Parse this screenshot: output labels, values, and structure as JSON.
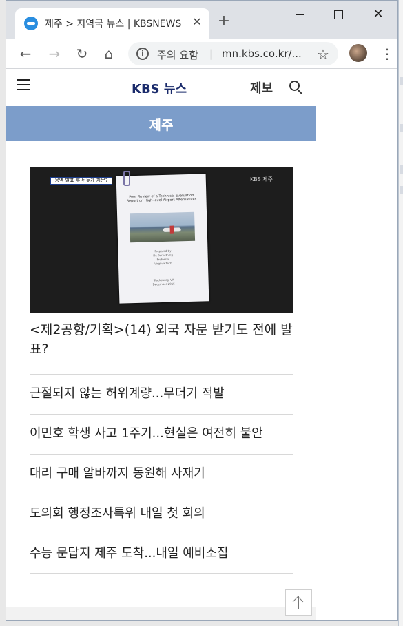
{
  "browser": {
    "tab": {
      "title": "제주 > 지역국 뉴스 | KBSNEWS",
      "close_label": "✕"
    },
    "new_tab_label": "+",
    "window_buttons": {
      "close_label": "✕"
    },
    "nav": {
      "back_label": "←",
      "forward_label": "→",
      "reload_label": "↻",
      "home_label": "⌂"
    },
    "omnibox": {
      "warning": "주의 요함",
      "separator": "|",
      "url": "mn.kbs.co.kr/..."
    },
    "menu_label": "⋮",
    "star_label": "☆"
  },
  "site": {
    "logo": "KBS 뉴스",
    "report_label": "제보",
    "region": "제주"
  },
  "featured": {
    "image_caption": "용역 발표 후 뒤늦게 자문?",
    "image_watermark": "KBS 제주",
    "document_title": "Peer Review of a Technical Evaluation Report on High-level Airport Alternatives",
    "document_body": "Prepared by\nDr. Something\nProfessor\nVirginia Tech",
    "document_date": "Blacksburg, VA\nDecember 2015",
    "headline": "<제2공항/기획>(14) 외국 자문 받기도 전에 발표?"
  },
  "news_list": [
    "근절되지 않는 허위계량...무더기 적발",
    "이민호 학생 사고 1주기...현실은 여전히 불안",
    "대리 구매 알바까지 동원해 사재기",
    "도의회 행정조사특위 내일 첫 회의",
    "수능 문답지 제주 도착...내일 예비소집"
  ],
  "colors": {
    "region_bar": "#7c9dca",
    "logo": "#1a2b6b",
    "favicon": "#2a8ee0"
  }
}
